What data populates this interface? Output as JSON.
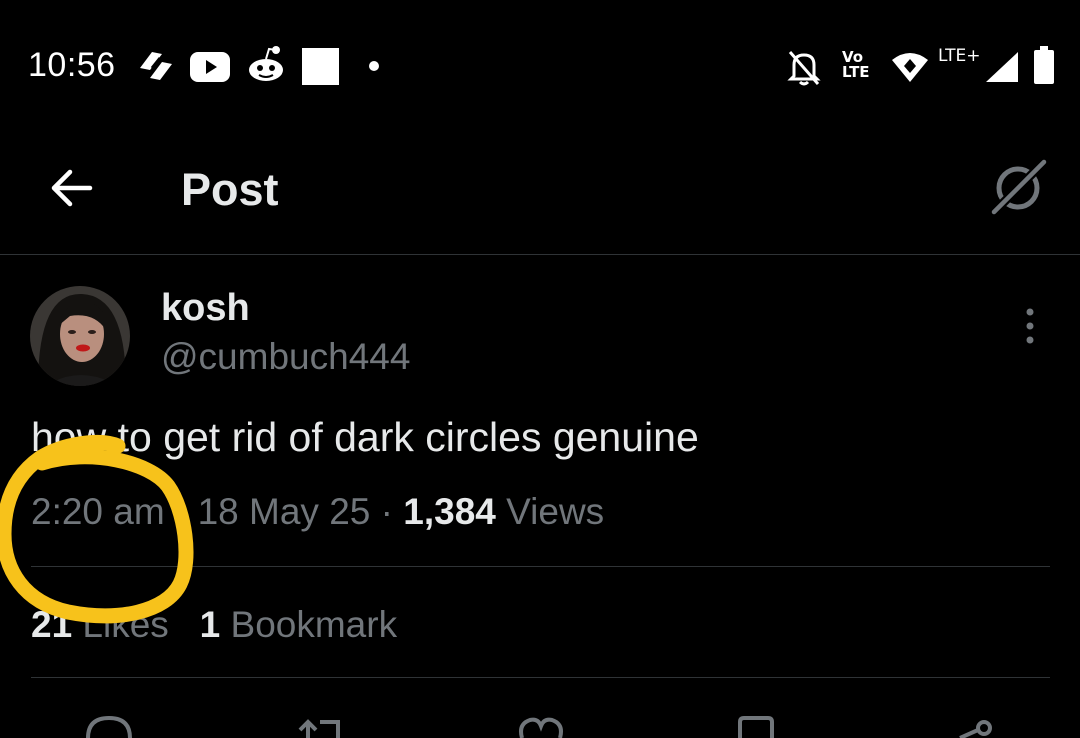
{
  "status_bar": {
    "time": "10:56",
    "volte_top": "Vo",
    "volte_bottom": "LTE",
    "network_label": "LTE+",
    "icons": [
      "payments-app-icon",
      "youtube-icon",
      "reddit-icon",
      "square-notification-icon",
      "dot-icon",
      "bell-off-icon",
      "volte-icon",
      "wifi-icon",
      "signal-icon",
      "battery-icon"
    ]
  },
  "header": {
    "title": "Post",
    "icons": [
      "back-arrow-icon",
      "grok-icon"
    ]
  },
  "post": {
    "display_name": "kosh",
    "handle": "@cumbuch444",
    "text": "how to get rid of dark circles genuine",
    "time": "2:20 am",
    "separator": " · ",
    "date": "18 May 25",
    "views_count": "1,384",
    "views_label": " Views",
    "likes_count": "21",
    "likes_label": " Likes",
    "bookmarks_count": "1",
    "bookmarks_label": " Bookmark"
  },
  "colors": {
    "background": "#000000",
    "text_primary": "#e7e9ea",
    "text_secondary": "#71767b",
    "divider": "#2f3336",
    "annotation": "#f7c21b"
  }
}
